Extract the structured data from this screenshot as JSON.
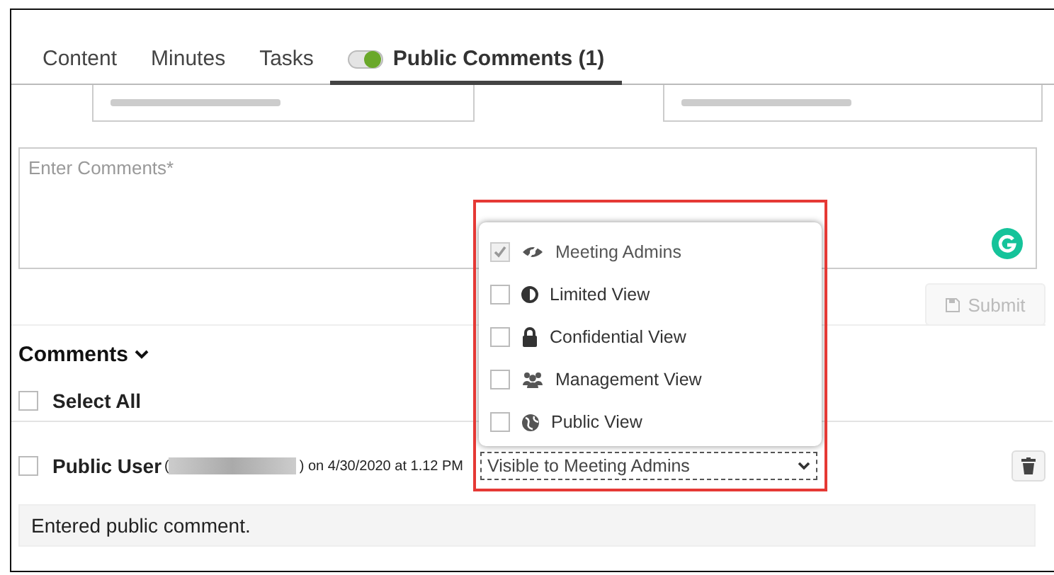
{
  "tabs": [
    {
      "label": "Content",
      "selected": false,
      "toggle": false
    },
    {
      "label": "Minutes",
      "selected": false,
      "toggle": false
    },
    {
      "label": "Tasks",
      "selected": false,
      "toggle": false
    },
    {
      "label": "Public Comments (1)",
      "selected": true,
      "toggle": true
    }
  ],
  "comment_field": {
    "placeholder": "Enter Comments*"
  },
  "submit_button": {
    "label": "Submit",
    "disabled": true
  },
  "comments_heading": "Comments",
  "select_all": {
    "label": "Select All",
    "checked": false
  },
  "comment": {
    "author": "Public User",
    "open_paren": "(",
    "date": ") on 4/30/2020 at 1.12 PM",
    "checked": false,
    "visibility": "Visible to Meeting Admins",
    "text": "Entered public comment."
  },
  "visibility_options": [
    {
      "label": "Meeting Admins",
      "kind": "eye",
      "checked": true,
      "disabled": true
    },
    {
      "label": "Limited View",
      "kind": "half",
      "checked": false,
      "disabled": false
    },
    {
      "label": "Confidential View",
      "kind": "lock",
      "checked": false,
      "disabled": false
    },
    {
      "label": "Management View",
      "kind": "people",
      "checked": false,
      "disabled": false
    },
    {
      "label": "Public View",
      "kind": "globe",
      "checked": false,
      "disabled": false
    }
  ]
}
